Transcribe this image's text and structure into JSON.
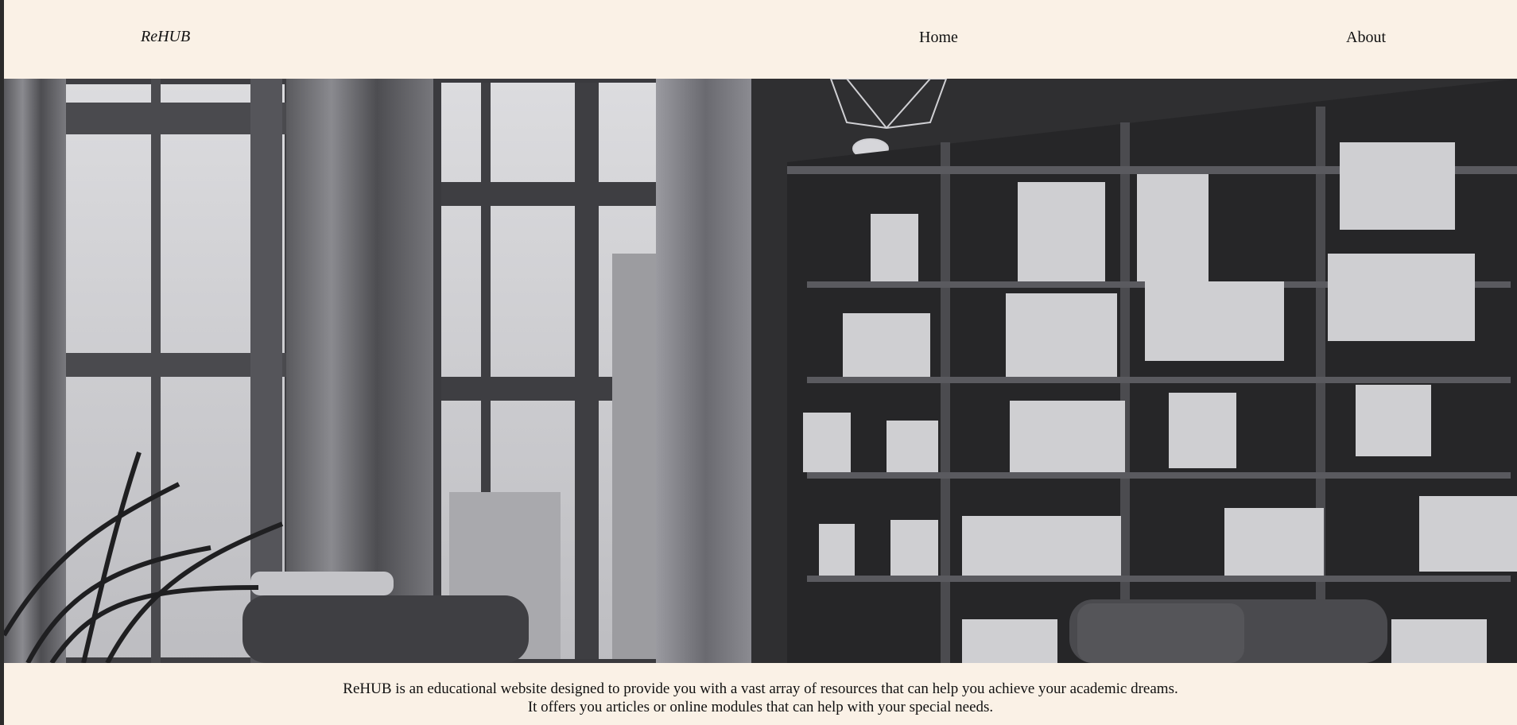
{
  "nav": {
    "brand": "ReHUB",
    "links": [
      {
        "label": "Home"
      },
      {
        "label": "About"
      }
    ]
  },
  "hero": {
    "image_icon": "library-room-photo"
  },
  "intro": {
    "line1": "ReHUB is an educational website designed to provide you with a vast array of resources that can help you achieve your academic dreams.",
    "line2": "It offers you articles or online modules that can help with your special needs."
  },
  "colors": {
    "page_bg": "#faf1e6",
    "text": "#111111",
    "photo_dark": "#2e2e30",
    "photo_light": "#d9d9dc"
  }
}
